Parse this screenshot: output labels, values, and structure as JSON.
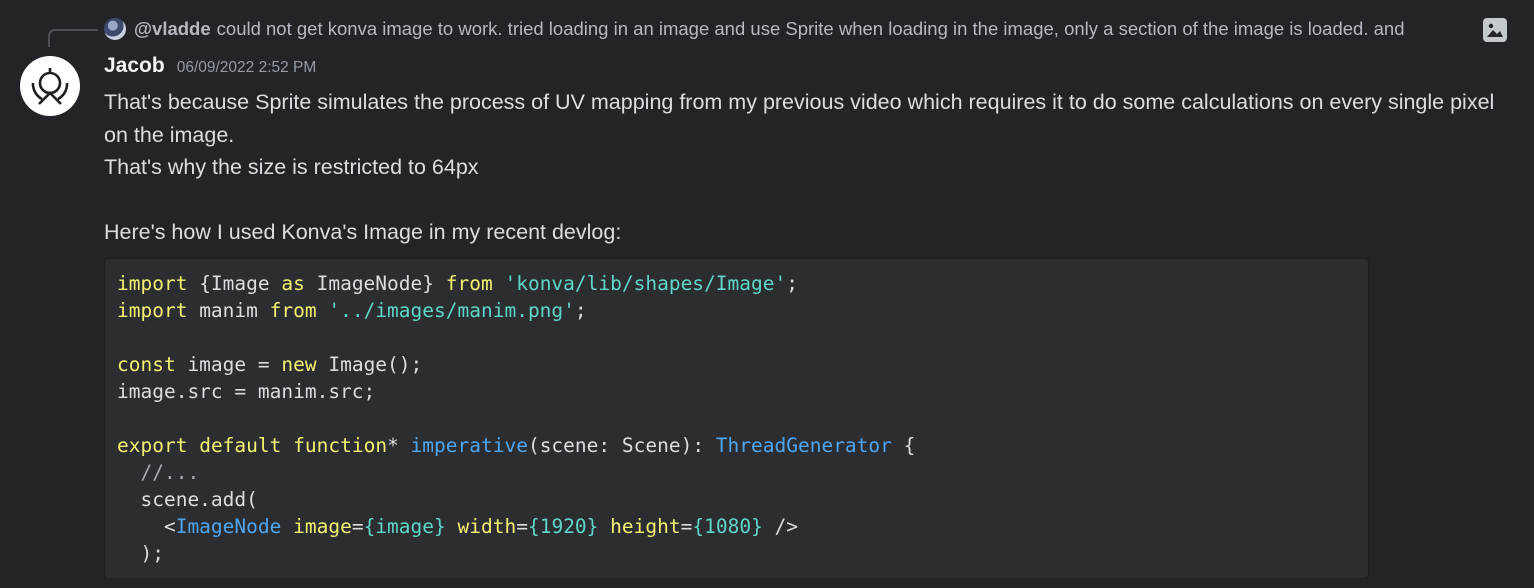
{
  "reply": {
    "username": "@vladde",
    "text": "could not get konva image to work. tried loading in an image and use Sprite  when loading in the image, only a section of the image is loaded. and",
    "image_icon": "image-icon"
  },
  "message": {
    "author": "Jacob",
    "timestamp": "06/09/2022 2:52 PM",
    "paragraph_1": "That's because Sprite simulates the process of UV mapping from my previous video which requires it to do some calculations on every single pixel on the image.",
    "paragraph_2": "That's why the size is restricted to 64px",
    "intro": "Here's how I used Konva's Image in my recent devlog:"
  },
  "code": {
    "language": "tsx",
    "lines": [
      [
        {
          "t": "import",
          "c": "kw"
        },
        {
          "t": " {Image ",
          "c": ""
        },
        {
          "t": "as",
          "c": "kw"
        },
        {
          "t": " ImageNode} ",
          "c": ""
        },
        {
          "t": "from",
          "c": "kw"
        },
        {
          "t": " ",
          "c": ""
        },
        {
          "t": "'konva/lib/shapes/Image'",
          "c": "str"
        },
        {
          "t": ";",
          "c": ""
        }
      ],
      [
        {
          "t": "import",
          "c": "kw"
        },
        {
          "t": " manim ",
          "c": ""
        },
        {
          "t": "from",
          "c": "kw"
        },
        {
          "t": " ",
          "c": ""
        },
        {
          "t": "'../images/manim.png'",
          "c": "str"
        },
        {
          "t": ";",
          "c": ""
        }
      ],
      [],
      [
        {
          "t": "const",
          "c": "kw"
        },
        {
          "t": " image = ",
          "c": ""
        },
        {
          "t": "new",
          "c": "kw"
        },
        {
          "t": " Image();",
          "c": ""
        }
      ],
      [
        {
          "t": "image.src = manim.src;",
          "c": ""
        }
      ],
      [],
      [
        {
          "t": "export",
          "c": "kw"
        },
        {
          "t": " ",
          "c": ""
        },
        {
          "t": "default",
          "c": "kw"
        },
        {
          "t": " ",
          "c": ""
        },
        {
          "t": "function",
          "c": "kw"
        },
        {
          "t": "* ",
          "c": ""
        },
        {
          "t": "imperative",
          "c": "fn"
        },
        {
          "t": "(scene: Scene): ",
          "c": ""
        },
        {
          "t": "ThreadGenerator",
          "c": "tp"
        },
        {
          "t": " {",
          "c": ""
        }
      ],
      [
        {
          "t": "  //...",
          "c": "cm"
        }
      ],
      [
        {
          "t": "  scene.add(",
          "c": ""
        }
      ],
      [
        {
          "t": "    <",
          "c": ""
        },
        {
          "t": "ImageNode",
          "c": "tp"
        },
        {
          "t": " ",
          "c": ""
        },
        {
          "t": "image",
          "c": "kw"
        },
        {
          "t": "=",
          "c": ""
        },
        {
          "t": "{image}",
          "c": "str"
        },
        {
          "t": " ",
          "c": ""
        },
        {
          "t": "width",
          "c": "kw"
        },
        {
          "t": "=",
          "c": ""
        },
        {
          "t": "{1920}",
          "c": "num"
        },
        {
          "t": " ",
          "c": ""
        },
        {
          "t": "height",
          "c": "kw"
        },
        {
          "t": "=",
          "c": ""
        },
        {
          "t": "{1080}",
          "c": "num"
        },
        {
          "t": " />",
          "c": ""
        }
      ],
      [
        {
          "t": "  );",
          "c": ""
        }
      ]
    ]
  }
}
